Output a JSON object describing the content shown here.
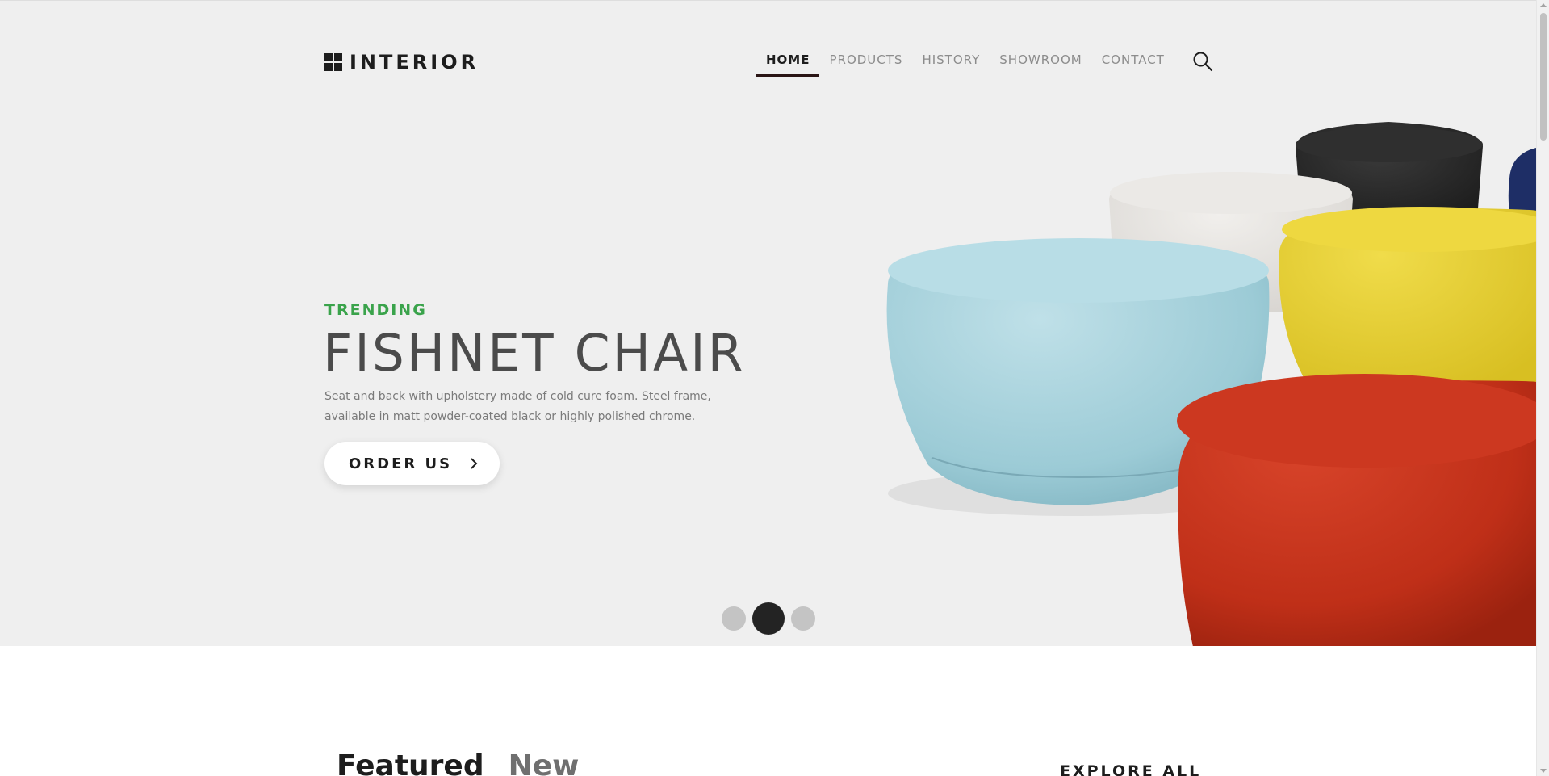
{
  "brand": {
    "name": "INTERIOR"
  },
  "nav": {
    "items": [
      {
        "label": "HOME",
        "active": true
      },
      {
        "label": "PRODUCTS",
        "active": false
      },
      {
        "label": "HISTORY",
        "active": false
      },
      {
        "label": "SHOWROOM",
        "active": false
      },
      {
        "label": "CONTACT",
        "active": false
      }
    ],
    "search_icon": "search-icon"
  },
  "hero": {
    "kicker": "TRENDING",
    "title": "FISHNET CHAIR",
    "description": "Seat and back with upholstery made of cold cure foam. Steel frame, available in matt powder-coated black or highly polished chrome.",
    "cta_label": "ORDER US",
    "cta_icon": "chevron-right-icon",
    "slides": {
      "count": 3,
      "active_index": 1
    }
  },
  "products": {
    "tabs": [
      {
        "label": "Featured",
        "active": true
      },
      {
        "label": "New",
        "active": false
      }
    ],
    "explore_label": "EXPLORE ALL"
  },
  "colors": {
    "hero_background": "#efefef",
    "accent_green": "#3aa34b",
    "text_dark": "#1d1d1d",
    "nav_muted": "#8c8c8c",
    "pouf_light_blue": "#a9d2dc",
    "pouf_red": "#c0301a",
    "pouf_yellow": "#e7d13a",
    "pouf_white": "#e6e4e1",
    "pouf_black": "#262626",
    "pouf_navy": "#1e2e66"
  }
}
